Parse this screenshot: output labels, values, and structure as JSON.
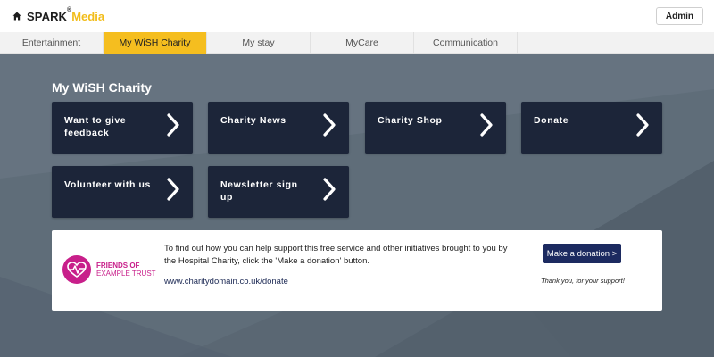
{
  "header": {
    "brand_spark": "SPARK",
    "brand_reg": "®",
    "brand_media": "Media",
    "admin_label": "Admin"
  },
  "tabs": [
    {
      "label": "Entertainment",
      "active": false
    },
    {
      "label": "My WiSH Charity",
      "active": true
    },
    {
      "label": "My stay",
      "active": false
    },
    {
      "label": "MyCare",
      "active": false
    },
    {
      "label": "Communication",
      "active": false
    }
  ],
  "main": {
    "title": "My WiSH Charity",
    "tiles": [
      {
        "label": "Want to give feedback"
      },
      {
        "label": "Charity News"
      },
      {
        "label": "Charity Shop"
      },
      {
        "label": "Donate"
      },
      {
        "label": "Volunteer with us"
      },
      {
        "label": "Newsletter sign up"
      }
    ]
  },
  "charity": {
    "logo_line1": "FRIENDS OF",
    "logo_line2": "EXAMPLE TRUST",
    "message": "To find out how you can help support this free service and other initiatives brought to you by the Hospital Charity, click the 'Make a donation' button.",
    "url": "www.charitydomain.co.uk/donate",
    "donate_label": "Make a donation >",
    "thanks": "Thank you, for your support!"
  },
  "colors": {
    "accent_yellow": "#f5be1f",
    "tile_navy": "#1c2539",
    "donate_navy": "#1c2a60",
    "charity_magenta": "#c81f8a",
    "background_slate": "#5f6d79"
  },
  "icons": {
    "home": "home-icon",
    "chevron": "chevron-right-icon",
    "heartbeat": "heartbeat-icon"
  }
}
